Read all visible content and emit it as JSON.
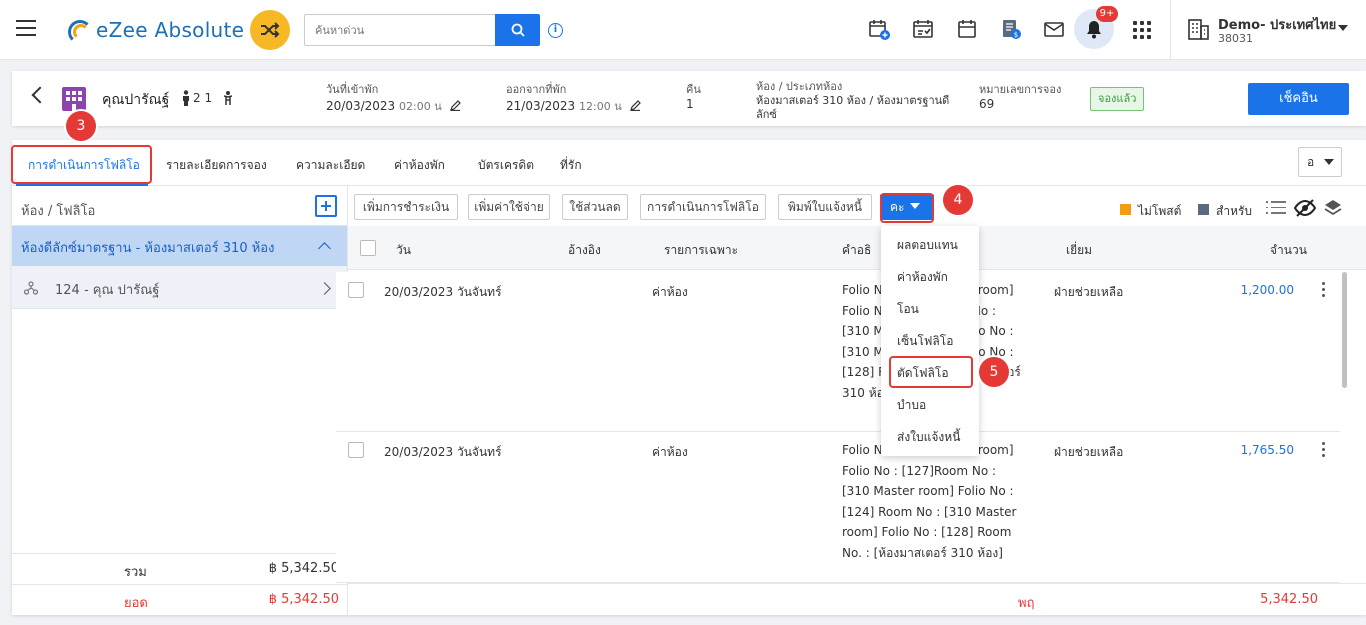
{
  "topbar": {
    "app_name": "eZee Absolute",
    "search_placeholder": "ค้นหาด่วน",
    "notification_badge": "9+",
    "property_name": "Demo- ประเทศไทย",
    "property_id": "38031",
    "icons": [
      "menu-icon",
      "shuffle-icon",
      "search-icon",
      "info-icon",
      "calendar-add-icon",
      "calendar-check-icon",
      "calendar-icon",
      "billing-icon",
      "mail-icon",
      "bell-icon",
      "apps-grid-icon",
      "building-icon"
    ]
  },
  "header": {
    "guest_name": "คุณปารัณฐ์",
    "pax": "2 1",
    "arrival_label": "วันที่เข้าพัก",
    "arrival_date": "20/03/2023",
    "arrival_time": "02:00 น",
    "departure_label": "ออกจากที่พัก",
    "departure_date": "21/03/2023",
    "departure_time": "12:00 น",
    "nights_label": "คืน",
    "nights_value": "1",
    "room_label": "ห้อง / ประเภทห้อง",
    "room_value_line1": "ห้องมาสเตอร์ 310 ห้อง / ห้องมาตรฐานดี",
    "room_value_line2": "ลักซ์",
    "reservation_label": "หมายเลขการจอง",
    "reservation_value": "69",
    "status": "จองแล้ว",
    "checkin_label": "เช็คอิน"
  },
  "tabs": {
    "items": [
      "การดำเนินการโฟลิโอ",
      "รายละเอียดการจอง",
      "ความละเอียด",
      "ค่าห้องพัก",
      "บัตรเครดิต",
      "ที่รัก"
    ],
    "select_value": "อ"
  },
  "left_pane": {
    "title": "ห้อง / โฟลิโอ",
    "room_group": "ห้องดีลักซ์มาตรฐาน - ห้องมาสเตอร์ 310 ห้อง",
    "folio": "124 - คุณ ปารัณฐ์",
    "total_label": "รวม",
    "total_value": "฿ 5,342.50",
    "balance_label": "ยอด",
    "balance_value": "฿ 5,342.50"
  },
  "toolbar": {
    "add_payment": "เพิ่มการชำระเงิน",
    "add_charge": "เพิ่มค่าใช้จ่าย",
    "apply_discount": "ใช้ส่วนลด",
    "folio_operations": "การดำเนินการโฟลิโอ",
    "print_invoice": "พิมพ์ใบแจ้งหนี้",
    "more": "คะ",
    "legend_unposted": "ไม่โพสต์",
    "legend_for": "สำหรับ",
    "colors": {
      "unposted": "#f39c12",
      "for": "#5a6b80"
    }
  },
  "table": {
    "headers": {
      "date": "วัน",
      "reference": "อ้างอิง",
      "particulars": "รายการเฉพาะ",
      "remark": "คำอธิ",
      "user": "เยี่ยม",
      "amount": "จำนวน"
    },
    "rows": [
      {
        "date": "20/03/2023 วันจันทร์",
        "particulars": "ค่าห้อง",
        "remark": "Folio No : [310 Master room] Folio No : [127]Room No : [310 Master room] Folio No : [310 Master room] Folio No : [128] Room No. : [ห้องมาสเตอร์ 310 ห้อง]",
        "user": "ฝ่ายช่วยเหลือ",
        "amount": "1,200.00"
      },
      {
        "date": "20/03/2023 วันจันทร์",
        "particulars": "ค่าห้อง",
        "remark": "Folio No : [310 Master room] Folio No : [127]Room No : [310 Master room] Folio No : [124] Room No : [310 Master room] Folio No : [128] Room No. : [ห้องมาสเตอร์ 310 ห้อง]",
        "user": "ฝ่ายช่วยเหลือ",
        "amount": "1,765.50"
      }
    ],
    "footer_label": "พฤ",
    "footer_value": "5,342.50"
  },
  "dropdown": {
    "items": [
      "ผลตอบแทน",
      "ค่าห้องพัก",
      "โอน",
      "เซ็นโฟลิโอ",
      "ตัดโฟลิโอ",
      "บำบอ",
      "ส่งใบแจ้งหนี้"
    ]
  },
  "callouts": [
    "3",
    "4",
    "5"
  ]
}
